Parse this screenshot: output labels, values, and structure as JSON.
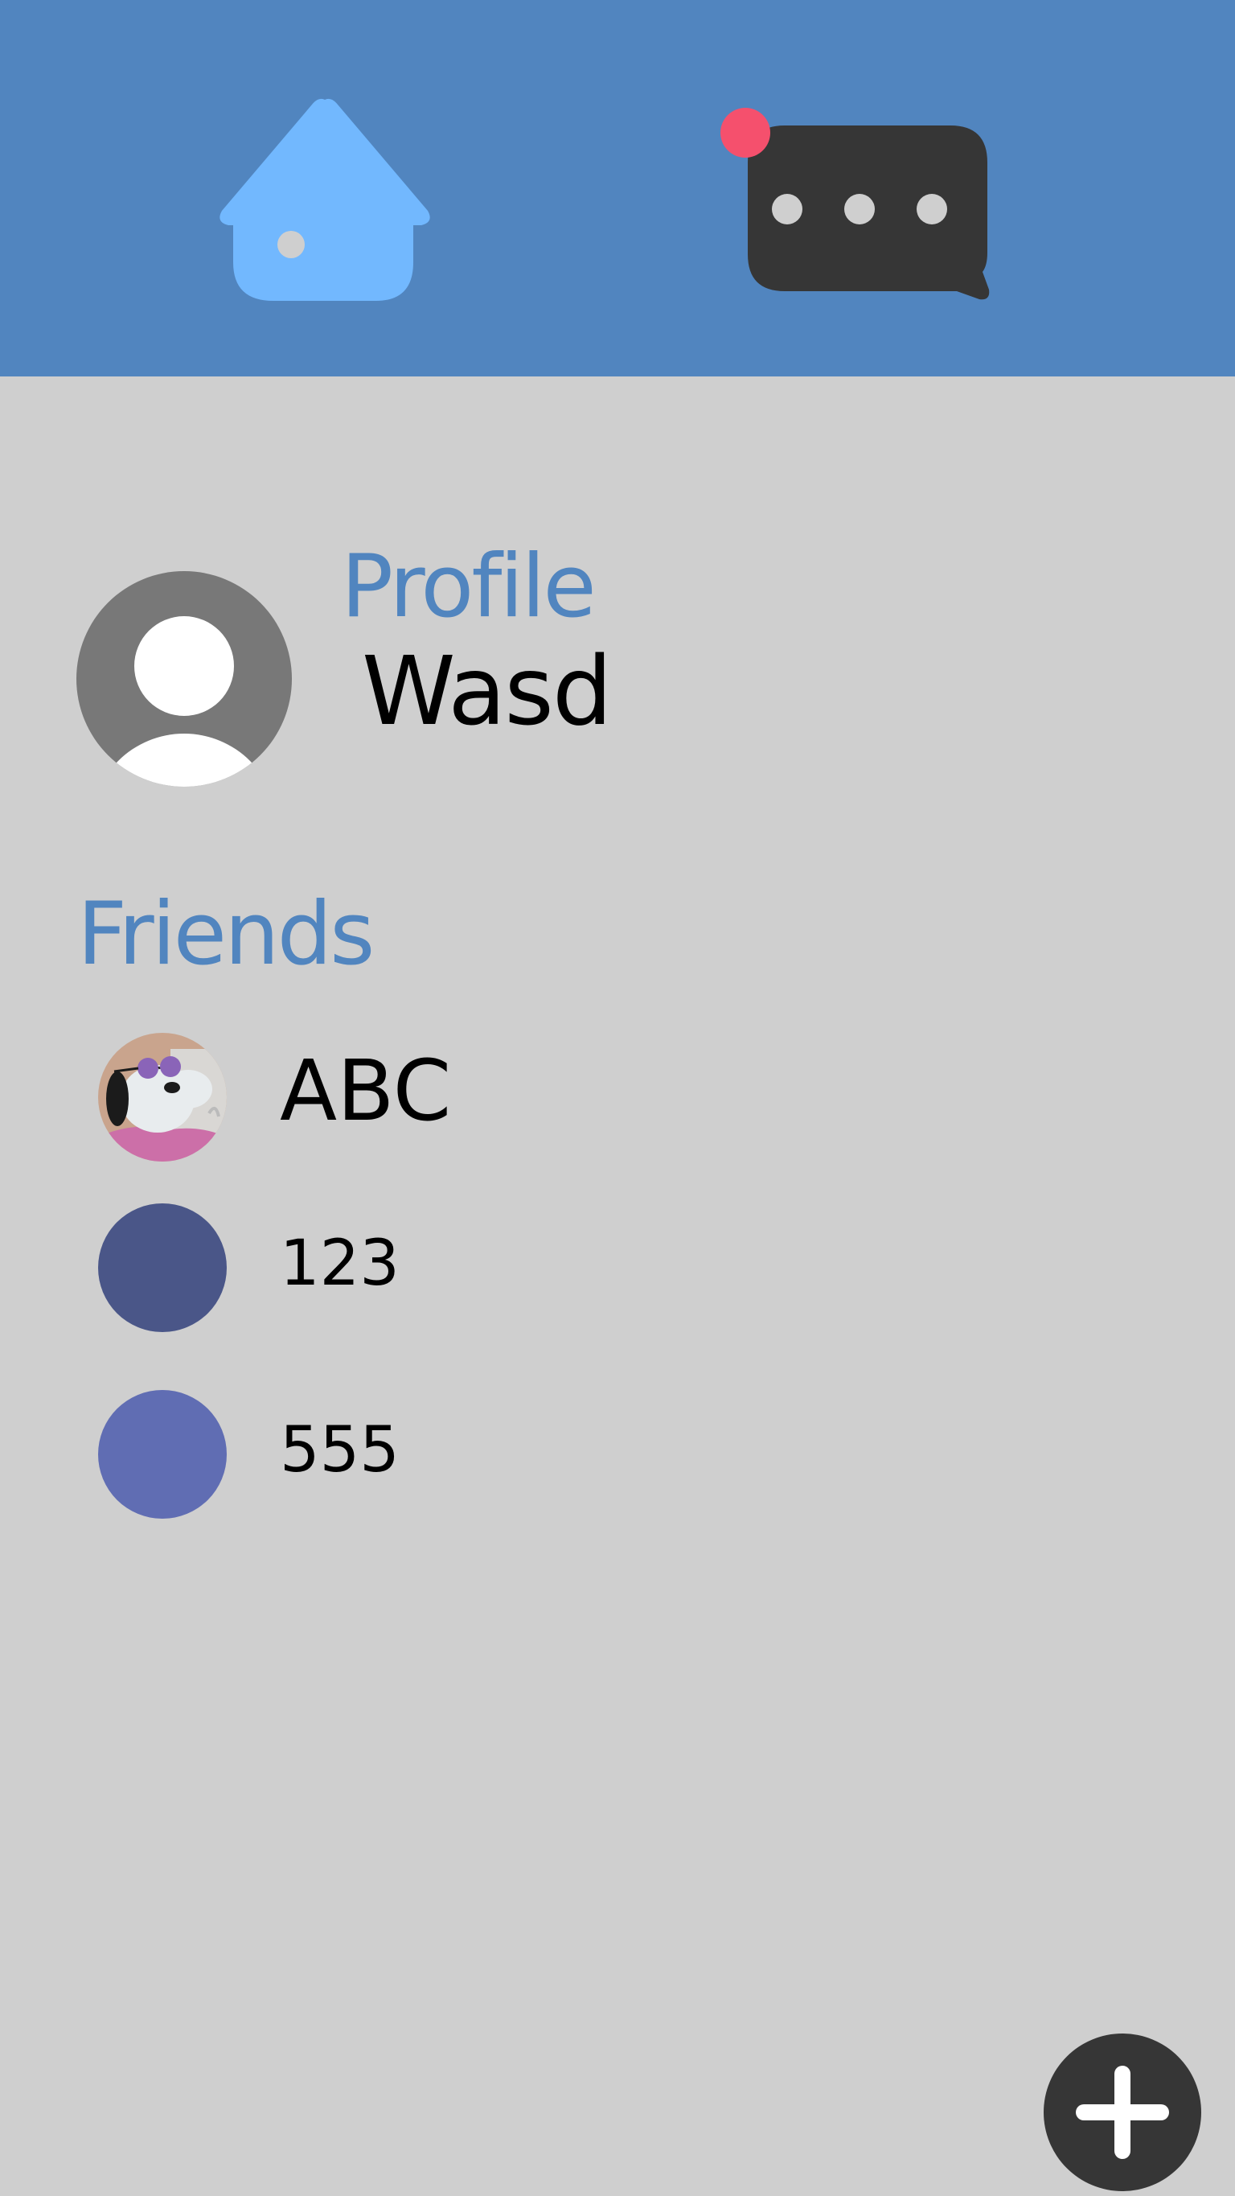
{
  "colors": {
    "header_bg": "#5185bf",
    "page_bg": "#cfcfcf",
    "accent": "#5185bf",
    "home_icon": "#72b8fe",
    "chat_icon": "#363636",
    "notification_dot": "#f5506d",
    "fab": "#363636"
  },
  "nav": {
    "home_icon": "home-icon",
    "messages_icon": "chat-bubble-icon",
    "has_notification": true
  },
  "profile": {
    "heading": "Profile",
    "name": "Wasd",
    "avatar_icon": "default-user-avatar"
  },
  "friends": {
    "heading": "Friends",
    "items": [
      {
        "name": "ABC",
        "avatar": "cartoon-dog-with-sunglasses"
      },
      {
        "name": "123",
        "avatar_color": "#4a5688"
      },
      {
        "name": "555",
        "avatar_color": "#606db3"
      }
    ]
  },
  "fab": {
    "icon": "plus-icon"
  }
}
